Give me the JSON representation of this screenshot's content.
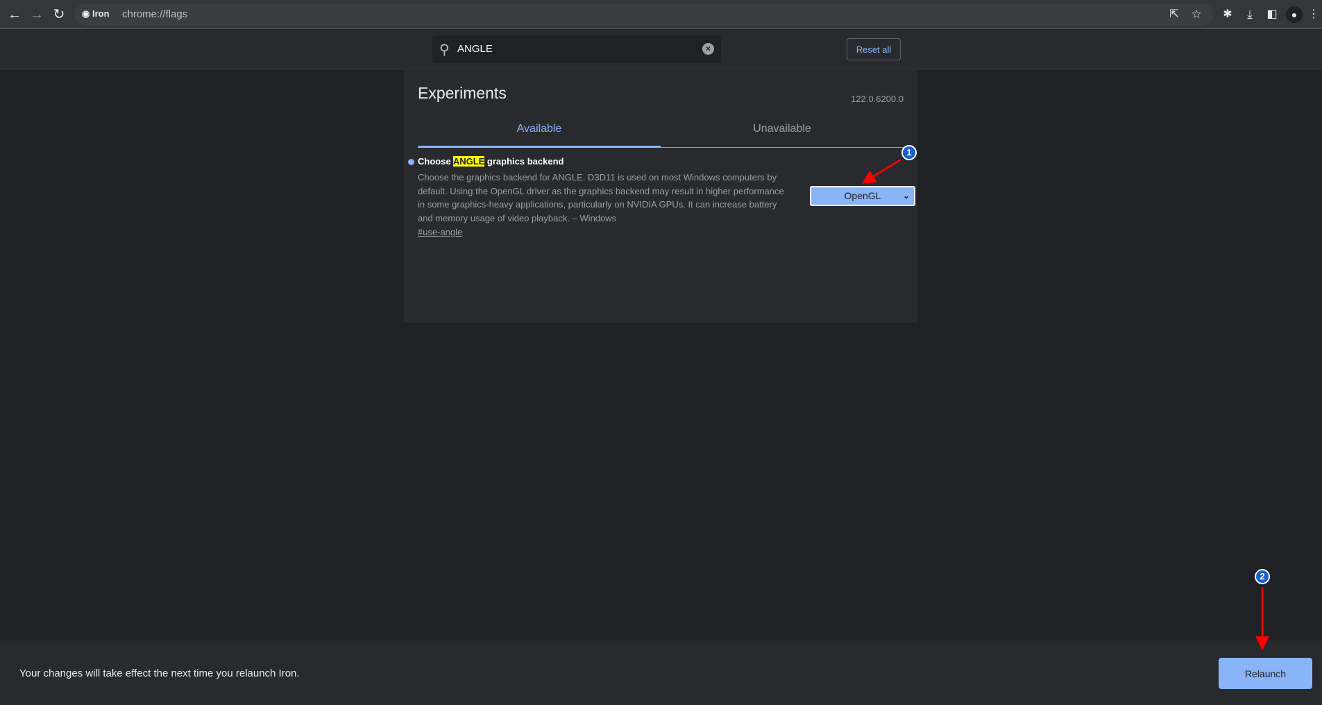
{
  "browser": {
    "site_label": "Iron",
    "url": "chrome://flags",
    "icons": [
      "back-icon",
      "forward-icon",
      "reload-icon",
      "share-icon",
      "star-icon",
      "extensions-icon",
      "download-icon",
      "side-panel-icon",
      "profile-icon",
      "menu-icon"
    ]
  },
  "header": {
    "search_value": "ANGLE",
    "reset_label": "Reset all"
  },
  "main": {
    "title": "Experiments",
    "version": "122.0.6200.0",
    "tabs": [
      {
        "label": "Available",
        "active": true
      },
      {
        "label": "Unavailable",
        "active": false
      }
    ]
  },
  "flag": {
    "title_before": "Choose ",
    "title_highlight": "ANGLE",
    "title_after": " graphics backend",
    "description": "Choose the graphics backend for ANGLE. D3D11 is used on most Windows computers by default. Using the OpenGL driver as the graphics backend may result in higher performance in some graphics-heavy applications, particularly on NVIDIA GPUs. It can increase battery and memory usage of video playback. – Windows",
    "link": "#use-angle",
    "selected": "OpenGL"
  },
  "bottom": {
    "message": "Your changes will take effect the next time you relaunch Iron.",
    "relaunch_label": "Relaunch"
  },
  "annotations": [
    {
      "label": "1",
      "color": "#ff0000"
    },
    {
      "label": "2",
      "color": "#ff0000"
    }
  ]
}
